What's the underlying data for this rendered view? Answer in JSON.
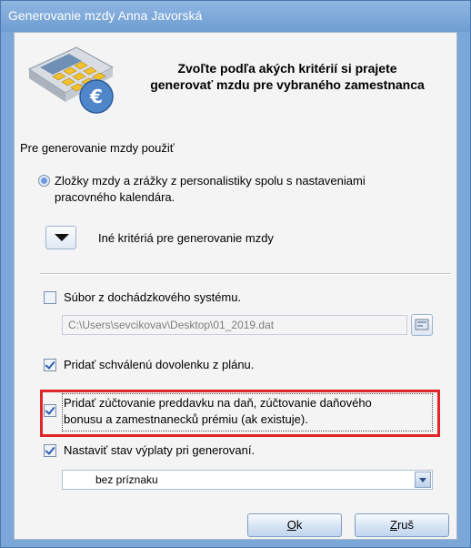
{
  "window": {
    "title": "Generovanie mzdy Anna Javorská"
  },
  "header": {
    "line1": "Zvoľte podľa akých kritérií si prajete",
    "line2": "generovať mzdu pre vybraného zamestnanca"
  },
  "section_label": "Pre generovanie mzdy použiť",
  "radio": {
    "line1": "Zložky mzdy a zrážky z personalistiky spolu s nastaveniami",
    "line2": "pracovného kalendára."
  },
  "expander_label": "Iné kritériá pre generovanie mzdy",
  "options": {
    "attendance_label": "Súbor z dochádzkového systému.",
    "attendance_checked": false,
    "attendance_path": "C:\\Users\\sevcikovav\\Desktop\\01_2019.dat",
    "vacation_label": "Pridať schválenú dovolenku z plánu.",
    "vacation_checked": true,
    "tax_line1": "Pridať zúčtovanie preddavku na daň, zúčtovanie daňového",
    "tax_line2": "bonusu a zamestnanecků prémiu (ak existuje).",
    "tax_checked": true,
    "status_label": "Nastaviť stav výplaty pri generovaní.",
    "status_checked": true,
    "status_value": "bez príznaku"
  },
  "buttons": {
    "ok_first": "O",
    "ok_rest": "k",
    "cancel_first": "Z",
    "cancel_rest": "ruš"
  },
  "colors": {
    "accent": "#7aa6d8",
    "highlight": "#e0262a"
  }
}
